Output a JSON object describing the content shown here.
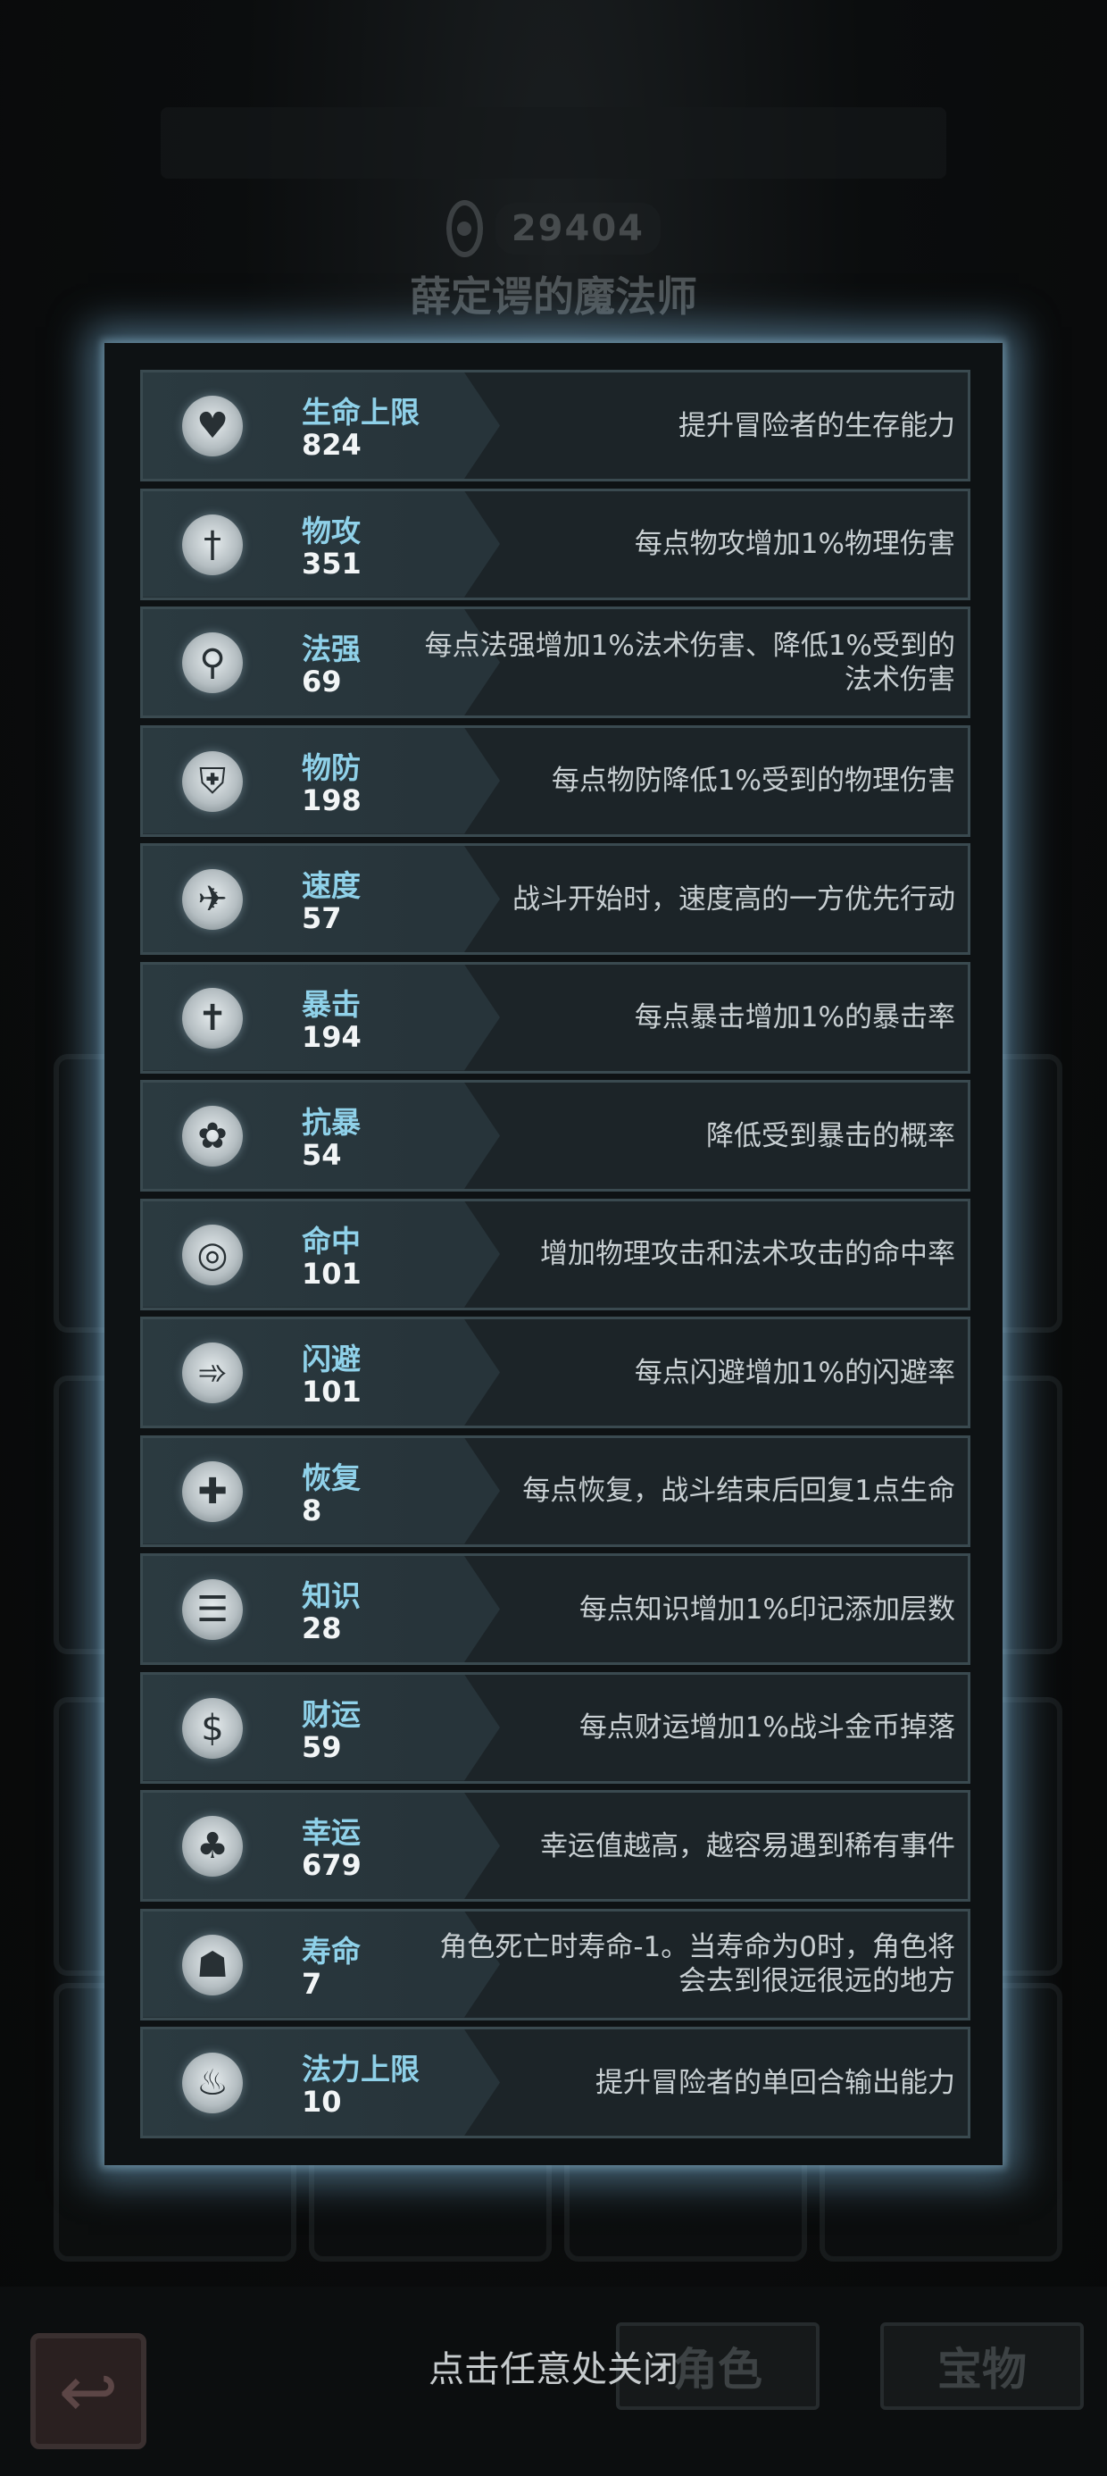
{
  "background": {
    "power_value": "29404",
    "hero_name": "薛定谔的魔法师",
    "tabs": {
      "role": "角色",
      "treasure": "宝物"
    }
  },
  "stats": [
    {
      "name": "生命上限",
      "value": "824",
      "desc": "提升冒险者的生存能力",
      "icon": "heart-up-icon"
    },
    {
      "name": "物攻",
      "value": "351",
      "desc": "每点物攻增加1%物理伤害",
      "icon": "sword-icon"
    },
    {
      "name": "法强",
      "value": "69",
      "desc": "每点法强增加1%法术伤害、降低1%受到的法术伤害",
      "icon": "staff-icon"
    },
    {
      "name": "物防",
      "value": "198",
      "desc": "每点物防降低1%受到的物理伤害",
      "icon": "armor-icon"
    },
    {
      "name": "速度",
      "value": "57",
      "desc": "战斗开始时，速度高的一方优先行动",
      "icon": "wing-icon"
    },
    {
      "name": "暴击",
      "value": "194",
      "desc": "每点暴击增加1%的暴击率",
      "icon": "crit-icon"
    },
    {
      "name": "抗暴",
      "value": "54",
      "desc": "降低受到暴击的概率",
      "icon": "crit-resist-icon"
    },
    {
      "name": "命中",
      "value": "101",
      "desc": "增加物理攻击和法术攻击的命中率",
      "icon": "target-icon"
    },
    {
      "name": "闪避",
      "value": "101",
      "desc": "每点闪避增加1%的闪避率",
      "icon": "dodge-icon"
    },
    {
      "name": "恢复",
      "value": "8",
      "desc": "每点恢复，战斗结束后回复1点生命",
      "icon": "heal-icon"
    },
    {
      "name": "知识",
      "value": "28",
      "desc": "每点知识增加1%印记添加层数",
      "icon": "book-icon"
    },
    {
      "name": "财运",
      "value": "59",
      "desc": "每点财运增加1%战斗金币掉落",
      "icon": "coin-icon"
    },
    {
      "name": "幸运",
      "value": "679",
      "desc": "幸运值越高，越容易遇到稀有事件",
      "icon": "clover-icon"
    },
    {
      "name": "寿命",
      "value": "7",
      "desc": "角色死亡时寿命-1。当寿命为0时，角色将会去到很远很远的地方",
      "icon": "tombstone-icon"
    },
    {
      "name": "法力上限",
      "value": "10",
      "desc": "提升冒险者的单回合输出能力",
      "icon": "mana-icon"
    }
  ],
  "close_hint": "点击任意处关闭"
}
